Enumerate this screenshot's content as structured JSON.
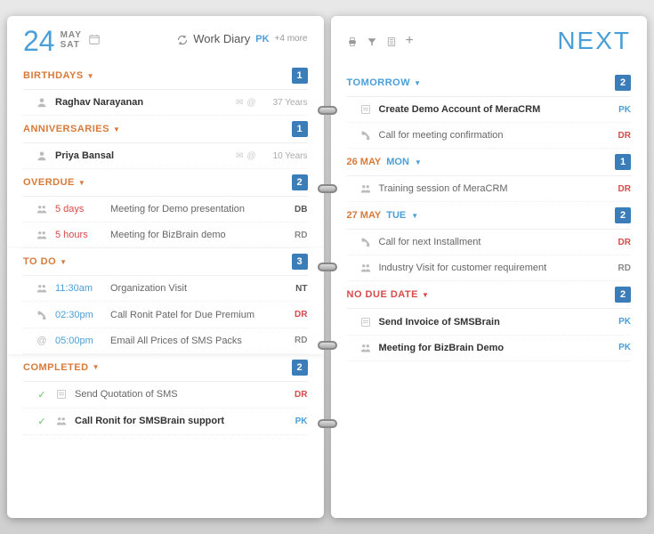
{
  "header": {
    "day_num": "24",
    "month": "MAY",
    "weekday": "SAT",
    "title": "Work Diary",
    "owner_badge": "PK",
    "more": "+4 more"
  },
  "next_label": "NEXT",
  "sections": {
    "birthdays": {
      "title": "BIRTHDAYS",
      "count": "1"
    },
    "anniversaries": {
      "title": "ANNIVERSARIES",
      "count": "1"
    },
    "overdue": {
      "title": "OVERDUE",
      "count": "2"
    },
    "todo": {
      "title": "TO DO",
      "count": "3"
    },
    "completed": {
      "title": "COMPLETED",
      "count": "2"
    },
    "tomorrow": {
      "title": "TOMORROW",
      "count": "2"
    },
    "nodue": {
      "title": "NO DUE DATE",
      "count": "2"
    }
  },
  "birthdays_rows": [
    {
      "name": "Raghav Narayanan",
      "meta": "37 Years"
    }
  ],
  "anniversaries_rows": [
    {
      "name": "Priya Bansal",
      "meta": "10 Years"
    }
  ],
  "overdue_rows": [
    {
      "time": "5 days",
      "text": "Meeting for Demo presentation",
      "tag": "DB"
    },
    {
      "time": "5 hours",
      "text": "Meeting for BizBrain demo",
      "tag": "RD"
    }
  ],
  "todo_rows": [
    {
      "time": "11:30am",
      "text": "Organization Visit",
      "tag": "NT",
      "tagColor": "dark"
    },
    {
      "time": "02:30pm",
      "text": "Call Ronit Patel for Due Premium",
      "tag": "DR",
      "tagColor": "red"
    },
    {
      "time": "05:00pm",
      "text": "Email All Prices of SMS Packs",
      "tag": "RD",
      "tagColor": "grey"
    }
  ],
  "completed_rows": [
    {
      "text": "Send Quotation of SMS",
      "tag": "DR",
      "tagColor": "red"
    },
    {
      "text": "Call Ronit for SMSBrain support",
      "tag": "PK",
      "tagColor": "blue"
    }
  ],
  "tomorrow_rows": [
    {
      "text": "Create Demo Account of MeraCRM",
      "tag": "PK",
      "tagColor": "blue",
      "bold": true
    },
    {
      "text": "Call for meeting confirmation",
      "tag": "DR",
      "tagColor": "red"
    }
  ],
  "days": [
    {
      "date": "26 MAY",
      "name": "MON",
      "count": "1",
      "rows": [
        {
          "text": "Training session of MeraCRM",
          "tag": "DR",
          "tagColor": "red"
        }
      ]
    },
    {
      "date": "27 MAY",
      "name": "TUE",
      "count": "2",
      "rows": [
        {
          "text": "Call for next Installment",
          "tag": "DR",
          "tagColor": "red"
        },
        {
          "text": "Industry Visit for customer requirement",
          "tag": "RD",
          "tagColor": "grey"
        }
      ]
    }
  ],
  "nodue_rows": [
    {
      "text": "Send Invoice of SMSBrain",
      "tag": "PK",
      "tagColor": "blue",
      "bold": true
    },
    {
      "text": "Meeting for BizBrain Demo",
      "tag": "PK",
      "tagColor": "blue",
      "bold": true
    }
  ]
}
